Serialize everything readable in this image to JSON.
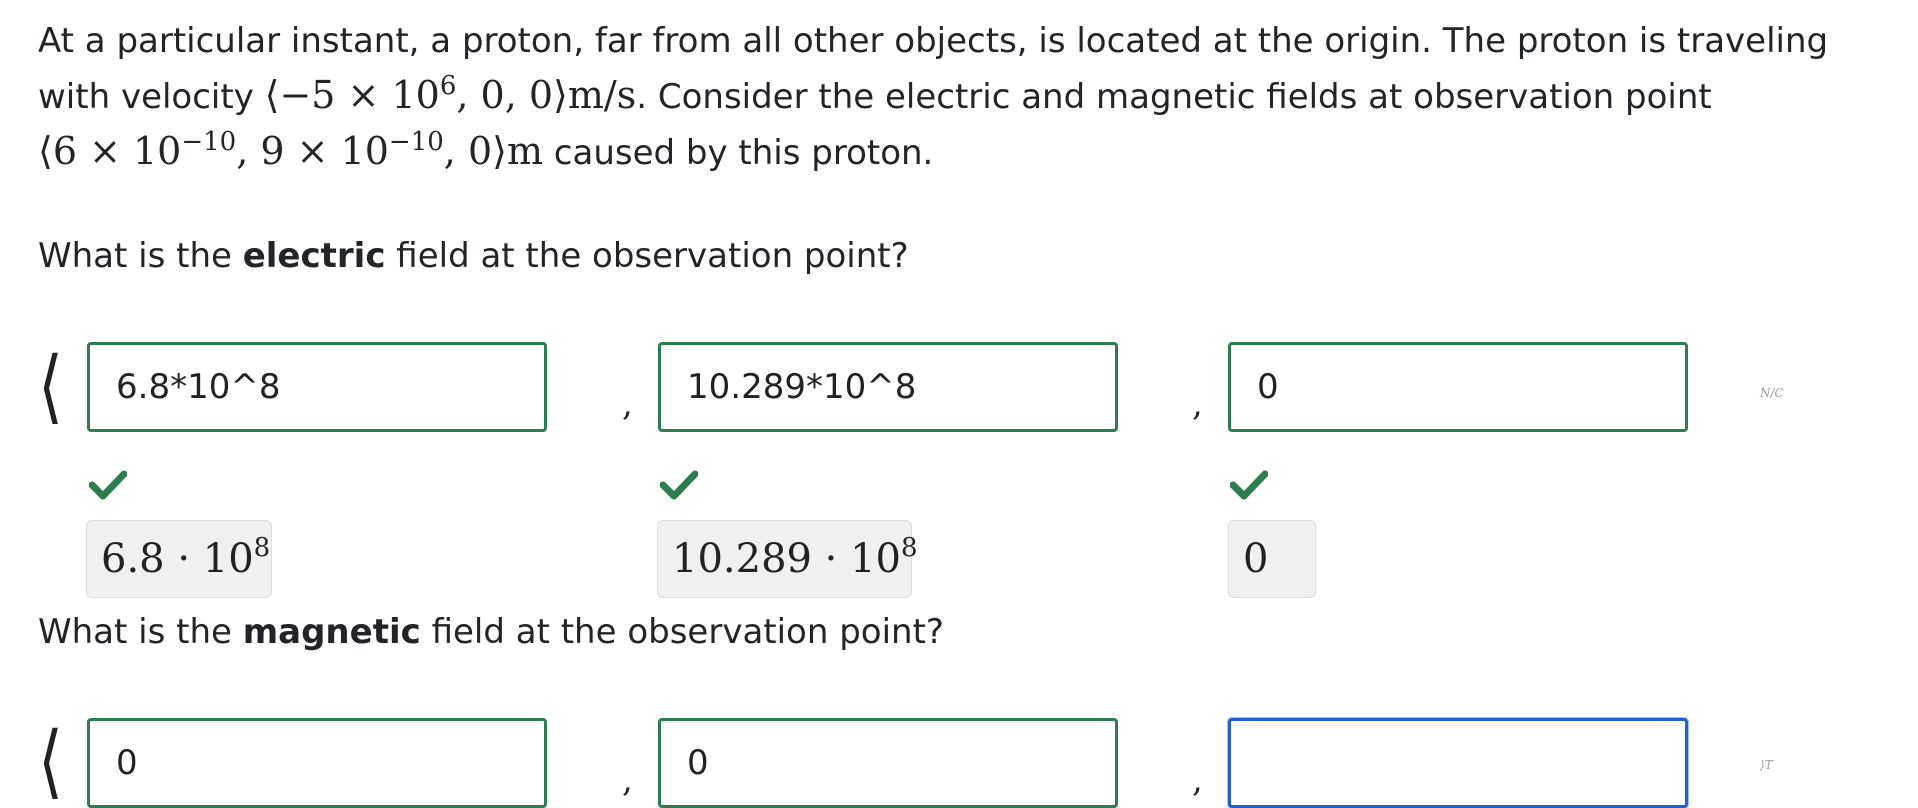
{
  "problem": {
    "intro_text": "At a particular instant, a proton, far from all other objects, is located at the origin. The proton is traveling with velocity",
    "velocity_math": "⟨−5 × 10",
    "velocity_exp": "6",
    "velocity_math_tail": ", 0, 0⟩m/s",
    "mid_text": ". Consider the electric and magnetic fields at observation point",
    "point_math_a": "⟨6 × 10",
    "point_exp_a": "−10",
    "point_math_b": ", 9 × 10",
    "point_exp_b": "−10",
    "point_math_c": ", 0⟩m",
    "end_text": " caused by this proton."
  },
  "electric_question": {
    "prefix": "What is the ",
    "bold": "electric",
    "suffix": " field at the observation point?"
  },
  "magnetic_question": {
    "prefix": "What is the ",
    "bold": "magnetic",
    "suffix": " field at the observation point?"
  },
  "electric_answers": {
    "bracket": "⟨",
    "separator": ",",
    "x_value": "6.8*10^8",
    "y_value": "10.289*10^8",
    "z_value": "0",
    "x_preview_base": "6.8 · 10",
    "x_preview_exp": "8",
    "y_preview_base": "10.289 · 10",
    "y_preview_exp": "8",
    "z_preview": "0",
    "unit_glyph": "N/C"
  },
  "magnetic_answers": {
    "bracket": "⟨",
    "separator": ",",
    "x_value": "0",
    "y_value": "0",
    "z_value": "",
    "unit_glyph": "⟩T"
  },
  "colors": {
    "correct_border": "#2e7d4f",
    "focus_border": "#1f5fcf",
    "check_green": "#2e7d4f"
  }
}
